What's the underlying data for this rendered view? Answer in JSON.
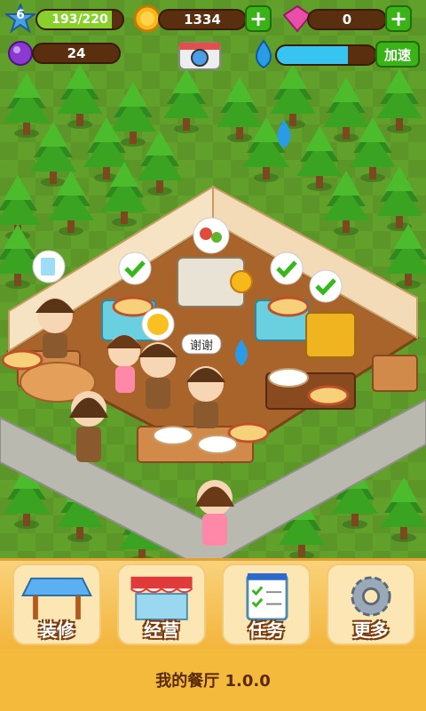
{
  "hud": {
    "level": "6",
    "xp_text": "193/220",
    "xp_fraction": 0.877,
    "coins": "1334",
    "gems": "0",
    "energy": "24",
    "water_fraction": 0.72,
    "speedup_label": "加速"
  },
  "scene": {
    "speech_thanks": "谢谢"
  },
  "menu": {
    "items": [
      {
        "label": "装修",
        "icon": "table-decor-icon"
      },
      {
        "label": "经营",
        "icon": "storefront-icon"
      },
      {
        "label": "任务",
        "icon": "task-list-icon"
      },
      {
        "label": "更多",
        "icon": "gear-icon"
      }
    ]
  },
  "footer": {
    "title": "我的餐厅 1.0.0"
  },
  "colors": {
    "grass": "#5f9a2a",
    "floor": "#a8642a",
    "hud_pill": "#5a2f10",
    "plus_green": "#39b318",
    "menu_bar": "#f4ba3b"
  }
}
